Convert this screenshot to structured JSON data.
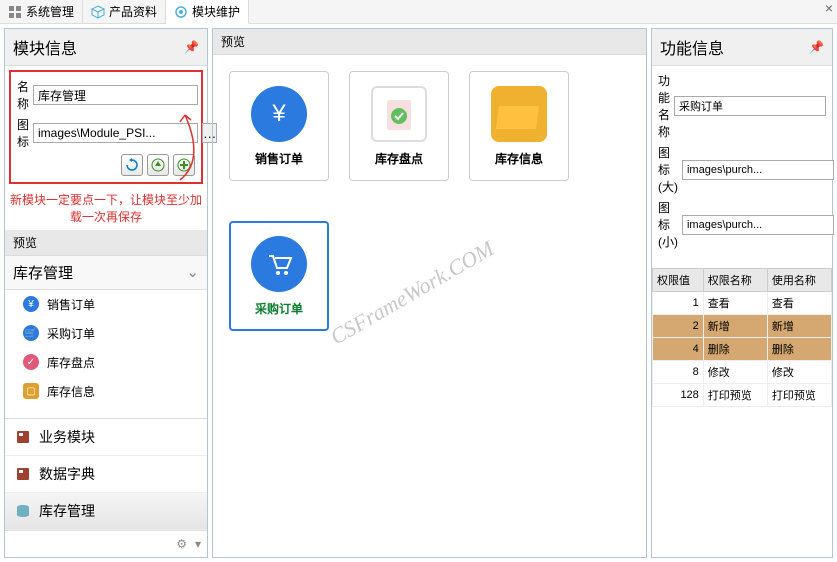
{
  "tabs": [
    {
      "icon_color": "#666",
      "label": "系统管理"
    },
    {
      "icon_color": "#4ab0e0",
      "label": "产品资料"
    },
    {
      "icon_color": "#4ab0e0",
      "label": "模块维护"
    }
  ],
  "left": {
    "title": "模块信息",
    "form": {
      "name_label": "名称",
      "name_value": "库存管理",
      "icon_label": "图标",
      "icon_value": "images\\Module_PSI...",
      "ellipsis": "…"
    },
    "hint": "新模块一定要点一下，让模块至少加载一次再保存",
    "preview_label": "预览",
    "tree_title": "库存管理",
    "items": [
      {
        "label": "销售订单",
        "color": "#2a7ae0"
      },
      {
        "label": "采购订单",
        "color": "#2a7ae0"
      },
      {
        "label": "库存盘点",
        "color": "#e05a7a"
      },
      {
        "label": "库存信息",
        "color": "#e0a030"
      }
    ],
    "bottom_nav": [
      {
        "label": "业务模块",
        "icon": "book-red"
      },
      {
        "label": "数据字典",
        "icon": "book-red"
      },
      {
        "label": "库存管理",
        "icon": "db"
      }
    ]
  },
  "center": {
    "title": "预览",
    "cards": [
      {
        "label": "销售订单",
        "bg": "#2a7ae0",
        "type": "circle",
        "glyph": "¥"
      },
      {
        "label": "库存盘点",
        "bg": "#fff",
        "type": "doc",
        "glyph": "✓"
      },
      {
        "label": "库存信息",
        "bg": "#f0b030",
        "type": "folder",
        "glyph": ""
      },
      {
        "label": "采购订单",
        "bg": "#2a7ae0",
        "type": "circle",
        "glyph": "🛒",
        "selected": true
      }
    ],
    "watermark": "CSFrameWork.COM"
  },
  "right": {
    "title": "功能信息",
    "form": {
      "name_label": "功能名称",
      "name_value": "采购订单",
      "icon_big_label": "图标(大)",
      "icon_big_value": "images\\purch...",
      "icon_small_label": "图标(小)",
      "icon_small_value": "images\\purch...",
      "ellipsis": "…"
    },
    "table": {
      "headers": [
        "权限值",
        "权限名称",
        "使用名称"
      ],
      "rows": [
        {
          "val": "1",
          "name": "查看",
          "use": "查看",
          "hl": false
        },
        {
          "val": "2",
          "name": "新增",
          "use": "新增",
          "hl": true
        },
        {
          "val": "4",
          "name": "删除",
          "use": "删除",
          "hl": true
        },
        {
          "val": "8",
          "name": "修改",
          "use": "修改",
          "hl": false
        },
        {
          "val": "128",
          "name": "打印预览",
          "use": "打印预览",
          "hl": false
        }
      ]
    }
  }
}
